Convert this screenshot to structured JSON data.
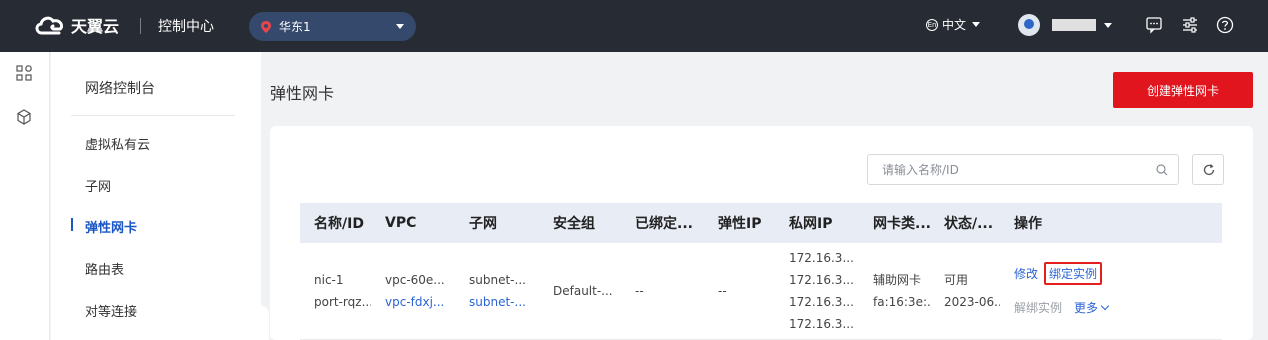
{
  "header": {
    "brand": "天翼云",
    "console": "控制中心",
    "region": "华东1",
    "language": "中文"
  },
  "subnav": {
    "title": "网络控制台",
    "items": [
      {
        "label": "虚拟私有云"
      },
      {
        "label": "子网"
      },
      {
        "label": "弹性网卡",
        "active": true
      },
      {
        "label": "路由表"
      },
      {
        "label": "对等连接"
      }
    ]
  },
  "page": {
    "title": "弹性网卡",
    "create_button": "创建弹性网卡"
  },
  "search": {
    "placeholder": "请输入名称/ID",
    "value": ""
  },
  "table": {
    "columns": [
      "名称/ID",
      "VPC",
      "子网",
      "安全组",
      "已绑定...",
      "弹性IP",
      "私网IP",
      "网卡类...",
      "状态/...",
      "操作"
    ],
    "rows": [
      {
        "name": "nic-1",
        "id": "port-rqz...",
        "vpc_name": "vpc-60e...",
        "vpc_id": "vpc-fdxj...",
        "subnet_name": "subnet-...",
        "subnet_id": "subnet-...",
        "security_group": "Default-...",
        "bound": "--",
        "eip": "--",
        "private_ips": [
          "172.16.3...",
          "172.16.3...",
          "172.16.3...",
          "172.16.3..."
        ],
        "nic_type": "辅助网卡",
        "mac": "fa:16:3e:...",
        "status": "可用",
        "created": "2023-06...",
        "ops": {
          "modify": "修改",
          "bind": "绑定实例",
          "unbind": "解绑实例",
          "more": "更多"
        }
      }
    ]
  },
  "colors": {
    "topbar": "#272b34",
    "primary_red": "#e0151e",
    "link_blue": "#2b64d6",
    "active_nav": "#1a56c5",
    "table_header": "#e7ecf5"
  }
}
